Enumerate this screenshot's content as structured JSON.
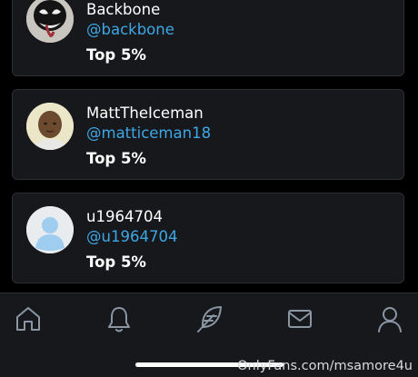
{
  "subscribers": [
    {
      "name": "Backbone",
      "handle": "@backbone",
      "rank": "Top 5%",
      "avatar": "venom-avatar"
    },
    {
      "name": "MattTheIceman",
      "handle": "@matticeman18",
      "rank": "Top 5%",
      "avatar": "photo-avatar"
    },
    {
      "name": "u1964704",
      "handle": "@u1964704",
      "rank": "Top 5%",
      "avatar": "default-avatar"
    }
  ],
  "navbar": {
    "items": [
      {
        "icon": "home-icon"
      },
      {
        "icon": "bell-icon"
      },
      {
        "icon": "feather-icon"
      },
      {
        "icon": "message-icon"
      },
      {
        "icon": "profile-icon"
      }
    ]
  },
  "watermark": "OnlyFans.com/msamore4u",
  "colors": {
    "background": "#000000",
    "card": "#16181b",
    "border": "#2c3035",
    "handle": "#3ea7e6",
    "icon": "#8a96a3"
  }
}
